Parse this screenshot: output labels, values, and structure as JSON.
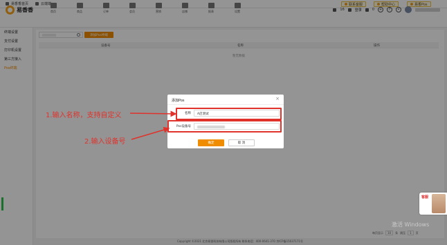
{
  "topbar": {
    "left": [
      "易香香首页",
      "云端端"
    ],
    "right": [
      "联系客服",
      "帮助中心",
      "易香Pos"
    ]
  },
  "header": {
    "logo_text": "易香香",
    "nav": [
      "首页",
      "商品",
      "订单",
      "会员",
      "营销",
      "店铺",
      "报表",
      "设置"
    ],
    "right": {
      "count": "16",
      "login": "登录",
      "zero": "0"
    }
  },
  "sidebar": {
    "items": [
      {
        "label": "终端设置"
      },
      {
        "label": "支付设置"
      },
      {
        "label": "打印机设置"
      },
      {
        "label": "第三方接入"
      },
      {
        "label": "Pos终端",
        "active": true
      }
    ]
  },
  "main": {
    "add_button": "添加Pos终端",
    "table_headers": [
      "设备号",
      "名称",
      "操作"
    ],
    "empty_text": "暂无数据"
  },
  "modal": {
    "title": "添加Pos",
    "close": "×",
    "fields": [
      {
        "label": "名称",
        "value": "A店测试"
      },
      {
        "label": "Pos设备号",
        "value": ""
      }
    ],
    "ok": "确定",
    "cancel": "取 消"
  },
  "annotations": {
    "step1": "1.输入名称，支持自定义",
    "step2": "2.输入设备号"
  },
  "pager": {
    "prefix": "每页显示",
    "size": "10",
    "suffix": "条",
    "goto": "跳至",
    "page": "1",
    "page_suffix": "页"
  },
  "footer": {
    "text": "Copyright ©2021 北京易香科技有限公司版权所有 联系电话：400-0641-370 京ICP备15037171号"
  },
  "watermark": {
    "line1": "激活 Windows"
  },
  "chat": {
    "text": "客服"
  },
  "colors": {
    "accent": "#f08c00",
    "annotation": "#e0322b",
    "chat_bar": "#2fbf4f"
  }
}
